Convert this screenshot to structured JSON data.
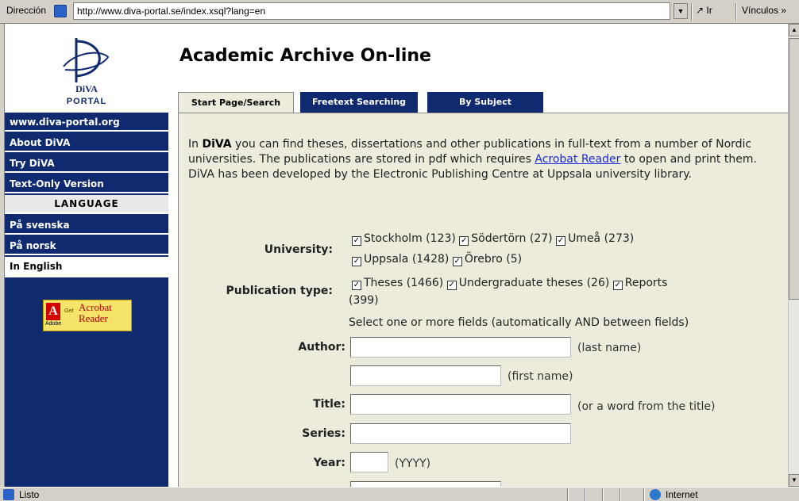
{
  "browser": {
    "address_label": "Dirección",
    "url": "http://www.diva-portal.se/index.xsql?lang=en",
    "go_label": "Ir",
    "links_label": "Vínculos",
    "status_text": "Listo",
    "zone_text": "Internet"
  },
  "logo": {
    "wordmark": "DiVA",
    "portal": "PORTAL"
  },
  "sidebar": {
    "items": [
      {
        "label": "www.diva-portal.org"
      },
      {
        "label": "About DiVA"
      },
      {
        "label": "Try DiVA"
      },
      {
        "label": "Text-Only Version"
      }
    ],
    "language_header": "LANGUAGE",
    "languages": [
      {
        "label": "På svenska"
      },
      {
        "label": "På norsk"
      },
      {
        "label": "In English",
        "active": true
      }
    ],
    "acrobat": {
      "brand": "Adobe",
      "get": "Get",
      "line1": "Acrobat",
      "line2": "Reader"
    }
  },
  "page": {
    "title": "Academic Archive On-line"
  },
  "tabs": [
    {
      "label": "Start Page/Search",
      "active": true
    },
    {
      "label": "Freetext Searching"
    },
    {
      "label": "By Subject"
    }
  ],
  "intro": {
    "prefix": "In ",
    "brand": "DiVA",
    "part1": " you can find theses, dissertations and other publications in full-text from a number of Nordic universities. The publications are stored in pdf which requires ",
    "link": "Acrobat Reader",
    "part2": " to open and print them. DiVA has been developed by the Electronic Publishing Centre at Uppsala university library."
  },
  "form": {
    "university_label": "University:",
    "universities": [
      {
        "label": "Stockholm (123)",
        "checked": true
      },
      {
        "label": "Södertörn (27)",
        "checked": true
      },
      {
        "label": "Umeå (273)",
        "checked": true
      },
      {
        "label": "Uppsala (1428)",
        "checked": true
      },
      {
        "label": "Örebro (5)",
        "checked": true
      }
    ],
    "pubtype_label": "Publication type:",
    "pubtypes": [
      {
        "label": "Theses (1466)",
        "checked": true
      },
      {
        "label": "Undergraduate theses (26)",
        "checked": true
      },
      {
        "label": "Reports",
        "checked": true
      }
    ],
    "pubtype_overflow": "(399)",
    "fields_note": "Select one or more fields (automatically AND between fields)",
    "author_label": "Author:",
    "author_lastname_hint": "(last name)",
    "author_firstname_hint": "(first name)",
    "title_label": "Title:",
    "title_hint": "(or a word from the title)",
    "series_label": "Series:",
    "year_label": "Year:",
    "year_hint": "(YYYY)"
  }
}
